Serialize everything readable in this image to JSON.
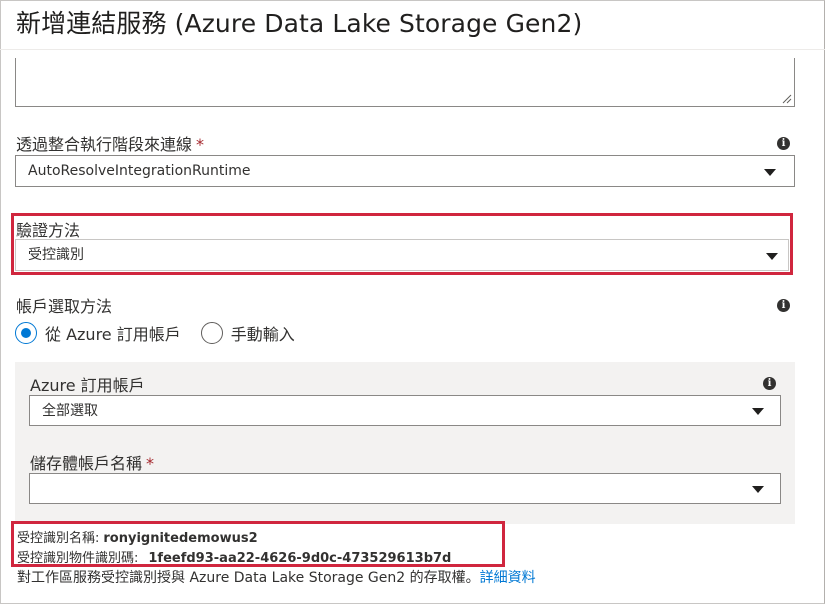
{
  "page": {
    "title": "新增連結服務 (Azure Data Lake Storage Gen2)"
  },
  "runtime": {
    "label": "透過整合執行階段來連線",
    "required_mark": "*",
    "info_icon": "info-icon",
    "value": "AutoResolveIntegrationRuntime"
  },
  "auth": {
    "label": "驗證方法",
    "value": "受控識別"
  },
  "account_selection": {
    "label": "帳戶選取方法",
    "info_icon": "info-icon",
    "options": [
      {
        "label": "從 Azure 訂用帳戶",
        "selected": true
      },
      {
        "label": "手動輸入",
        "selected": false
      }
    ]
  },
  "subscription": {
    "label": "Azure 訂用帳戶",
    "info_icon": "info-icon",
    "value": "全部選取"
  },
  "storage_account": {
    "label": "儲存體帳戶名稱",
    "required_mark": "*",
    "value": ""
  },
  "managed_identity": {
    "name_label": "受控識別名稱:",
    "name_value": "ronyignitedemowus2",
    "object_id_label": "受控識別物件識別碼:",
    "object_id_value": "1feefd93-aa22-4626-9d0c-473529613b7d"
  },
  "footer": {
    "text": "對工作區服務受控識別授與 Azure Data Lake Storage Gen2 的存取權。",
    "link": "詳細資料"
  },
  "colors": {
    "accent": "#0078d4",
    "highlight": "#d0263e",
    "required": "#a4262c",
    "panel": "#f3f2f1"
  }
}
